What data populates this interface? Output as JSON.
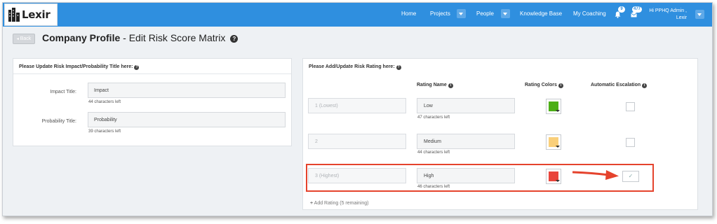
{
  "nav": {
    "logo_text": "Lexir",
    "items": [
      {
        "label": "Home"
      },
      {
        "label": "Projects"
      },
      {
        "label": "People"
      },
      {
        "label": "Knowledge Base"
      },
      {
        "label": "My Coaching"
      }
    ],
    "notifications_count": "9",
    "messages_count": "477",
    "user_greeting": "Hi PPHQ Admin ,",
    "user_org": "Lexir"
  },
  "header": {
    "back_label": "Back",
    "title_bold": "Company Profile",
    "title_rest": " - Edit Risk Score Matrix"
  },
  "left_panel": {
    "heading": "Please Update Risk Impact/Probability Title here:",
    "fields": [
      {
        "label": "Impact Title:",
        "value": "Impact",
        "hint": "44 characters left"
      },
      {
        "label": "Probability Title:",
        "value": "Probability",
        "hint": "39 characters left"
      }
    ]
  },
  "right_panel": {
    "heading": "Please Add/Update Risk Rating here:",
    "columns": {
      "rating_name": "Rating Name",
      "rating_colors": "Rating Colors",
      "automatic_escalation": "Automatic Escalation"
    },
    "ratings": [
      {
        "level": "1 (Lowest)",
        "name": "Low",
        "hint": "47 characters left",
        "color": "#4caf16",
        "escalation": false
      },
      {
        "level": "2",
        "name": "Medium",
        "hint": "44 characters left",
        "color": "#f9cf7a",
        "escalation": false
      },
      {
        "level": "3 (Highest)",
        "name": "High",
        "hint": "46 characters left",
        "color": "#e9453c",
        "escalation": true
      }
    ],
    "add_rating_label": "Add Rating (5 remaining)"
  },
  "colors": {
    "nav_bg": "#2f8fdf",
    "highlight": "#e5432d"
  }
}
